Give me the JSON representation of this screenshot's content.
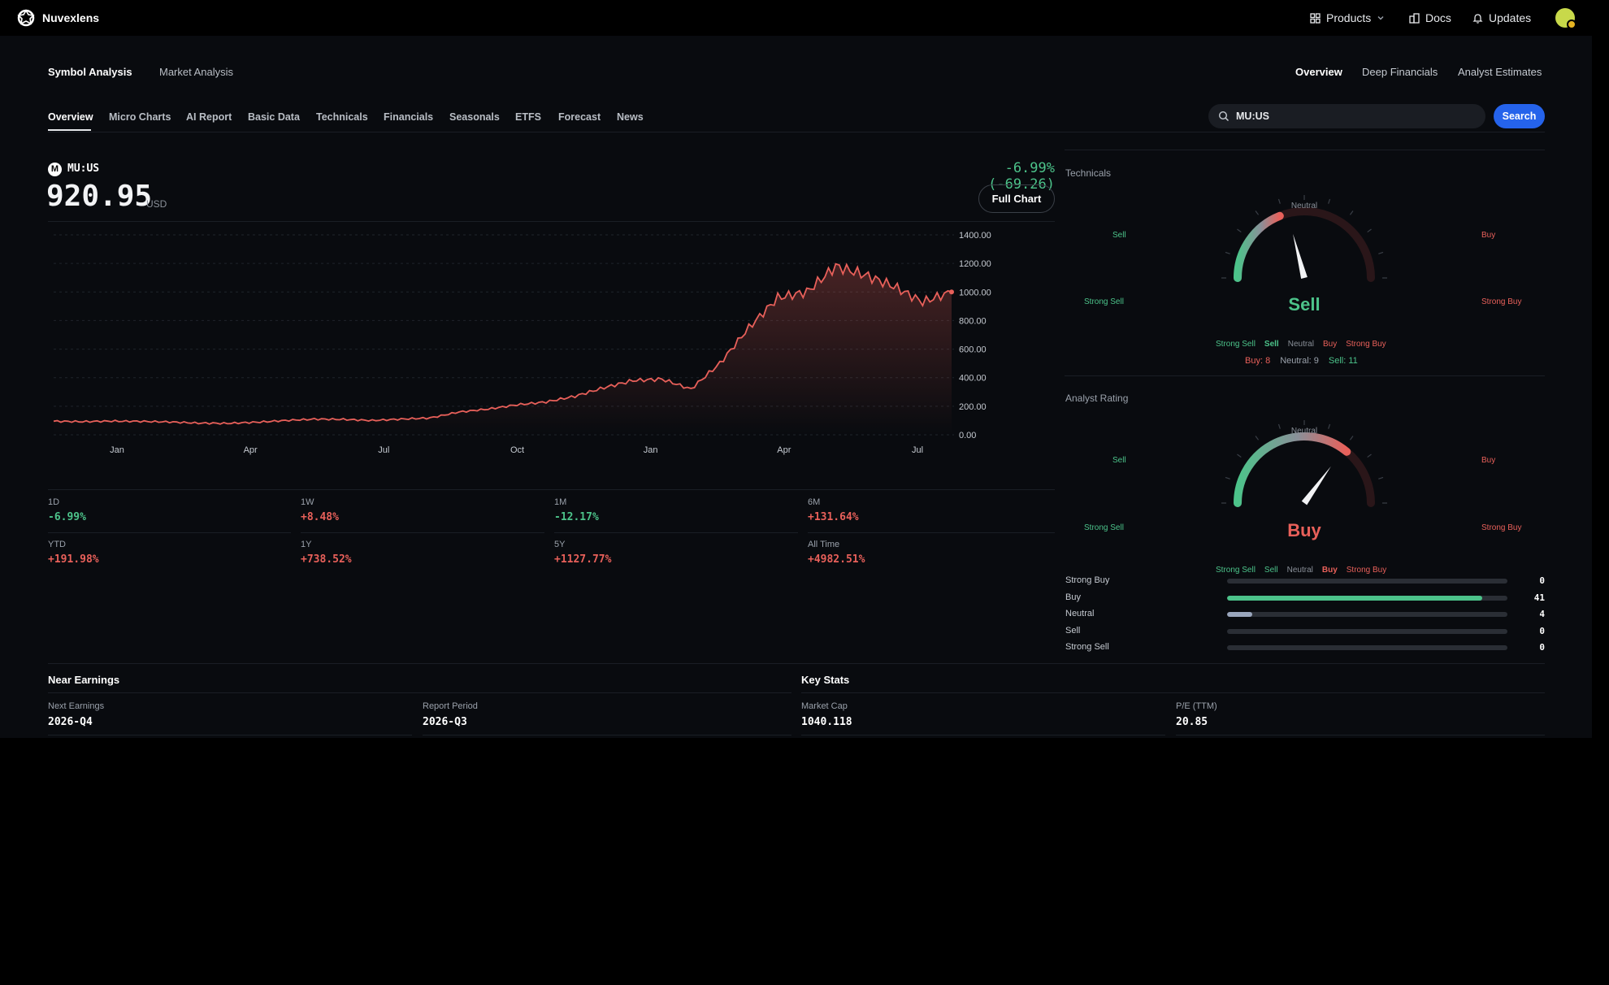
{
  "brand": {
    "name": "Nuvexlens"
  },
  "topnav": {
    "products": "Products",
    "docs": "Docs",
    "updates": "Updates"
  },
  "subnav": {
    "left": [
      "Symbol Analysis",
      "Market Analysis"
    ],
    "right": [
      "Overview",
      "Deep Financials",
      "Analyst Estimates"
    ]
  },
  "tabs": [
    "Overview",
    "Micro Charts",
    "AI Report",
    "Basic Data",
    "Technicals",
    "Financials",
    "Seasonals",
    "ETFS",
    "Forecast",
    "News"
  ],
  "search": {
    "value": "MU:US",
    "button_label": "Search"
  },
  "quote": {
    "logo_letter": "M",
    "symbol": "MU:US",
    "price": "920.95",
    "currency": "USD",
    "change": "-6.99% (-69.26)",
    "full_chart_label": "Full Chart"
  },
  "colors": {
    "up": "#e8605a",
    "down": "#4cc38a",
    "accent": "#2563eb",
    "neutral": "#8a9099"
  },
  "performance": [
    {
      "label": "1D",
      "value": "-6.99%",
      "dir": "down"
    },
    {
      "label": "1W",
      "value": "+8.48%",
      "dir": "up"
    },
    {
      "label": "1M",
      "value": "-12.17%",
      "dir": "down"
    },
    {
      "label": "6M",
      "value": "+131.64%",
      "dir": "up"
    },
    {
      "label": "YTD",
      "value": "+191.98%",
      "dir": "up"
    },
    {
      "label": "1Y",
      "value": "+738.52%",
      "dir": "up"
    },
    {
      "label": "5Y",
      "value": "+1127.77%",
      "dir": "up"
    },
    {
      "label": "All Time",
      "value": "+4982.51%",
      "dir": "up"
    }
  ],
  "chart_data": {
    "type": "area",
    "x": [
      "Jan",
      "Jan",
      "Feb",
      "Mar",
      "Mar",
      "Apr",
      "May",
      "May",
      "Jun",
      "Jul",
      "Jul",
      "Aug",
      "Sep",
      "Sep",
      "Oct",
      "Nov",
      "Nov",
      "Dec",
      "Jan",
      "Jan",
      "Feb",
      "Mar",
      "Mar",
      "Apr",
      "Apr",
      "May",
      "May",
      "Jun",
      "Jun",
      "Jul",
      "Jul",
      "Jul"
    ],
    "tick_labels": [
      "Jan",
      "Apr",
      "Jul",
      "Oct",
      "Jan",
      "Apr",
      "Jul"
    ],
    "y_ticks": [
      "1400.00",
      "1200.00",
      "1000.00",
      "800.00",
      "600.00",
      "400.00",
      "200.00",
      "0.00"
    ],
    "ylim": [
      0,
      1400
    ],
    "series": [
      {
        "values": [
          95,
          92,
          96,
          94,
          90,
          82,
          80,
          88,
          100,
          110,
          108,
          100,
          110,
          118,
          160,
          180,
          210,
          230,
          270,
          330,
          380,
          390,
          320,
          500,
          750,
          960,
          1000,
          1180,
          1120,
          1040,
          930,
          1000
        ]
      }
    ],
    "grid": true,
    "legend": "none"
  },
  "technicals": {
    "title": "Technicals",
    "gauge_labels": {
      "sell": "Sell",
      "buy": "Buy",
      "strong_sell": "Strong Sell",
      "strong_buy": "Strong Buy",
      "neutral": "Neutral"
    },
    "verdict": "Sell",
    "needle_level": 0.42,
    "legend": [
      "Strong Sell",
      "Sell",
      "Neutral",
      "Buy",
      "Strong Buy"
    ],
    "counts": {
      "buy": "Buy: 8",
      "neutral": "Neutral: 9",
      "sell": "Sell: 11"
    }
  },
  "analyst": {
    "title": "Analyst Rating",
    "gauge_labels": {
      "sell": "Sell",
      "buy": "Buy",
      "strong_sell": "Strong Sell",
      "strong_buy": "Strong Buy",
      "neutral": "Neutral"
    },
    "verdict": "Buy",
    "needle_level": 0.7,
    "legend": [
      "Strong Sell",
      "Sell",
      "Neutral",
      "Buy",
      "Strong Buy"
    ],
    "distribution": [
      {
        "label": "Strong Buy",
        "count": "0",
        "value": 0
      },
      {
        "label": "Buy",
        "count": "41",
        "value": 41
      },
      {
        "label": "Neutral",
        "count": "4",
        "value": 4
      },
      {
        "label": "Sell",
        "count": "0",
        "value": 0
      },
      {
        "label": "Strong Sell",
        "count": "0",
        "value": 0
      }
    ],
    "distribution_max": 45
  },
  "earnings": {
    "title": "Near Earnings",
    "next_label": "Next Earnings",
    "next_value": "2026-Q4",
    "period_label": "Report Period",
    "period_value": "2026-Q3"
  },
  "keystats": {
    "title": "Key Stats",
    "mcap_label": "Market Cap",
    "mcap_value": "1040.118",
    "pe_label": "P/E (TTM)",
    "pe_value": "20.85"
  }
}
